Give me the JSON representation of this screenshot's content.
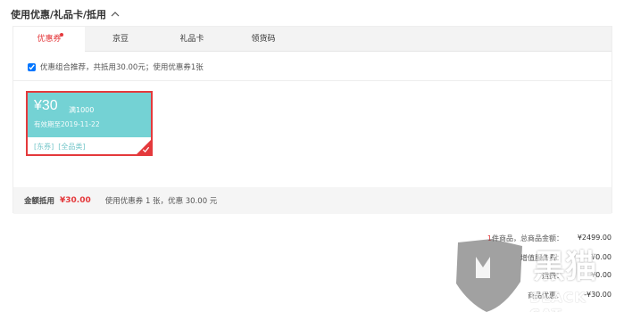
{
  "header": {
    "title": "使用优惠/礼品卡/抵用"
  },
  "tabs": [
    {
      "label": "优惠券",
      "active": true
    },
    {
      "label": "京豆"
    },
    {
      "label": "礼品卡"
    },
    {
      "label": "领货码"
    }
  ],
  "combo": {
    "label": "优惠组合推荐，共抵用30.00元；使用优惠券1张",
    "checked": true
  },
  "coupon": {
    "amount": "¥30",
    "condition": "满1000",
    "expiry": "有效期至2019-11-22",
    "tag1": "[东券]",
    "tag2": "[全品类]"
  },
  "summary": {
    "label": "金额抵用",
    "amount": "¥30.00",
    "desc": "使用优惠券 1 张，优惠 30.00 元"
  },
  "totals": {
    "row1_label": "件商品，总商品金额：",
    "row1_prefix": "1",
    "row1_value": "¥2499.00",
    "row2_label": "增值服务费：",
    "row2_value": "¥0.00",
    "row3_label": "运费：",
    "row3_value": "¥0.00",
    "row4_label": "商品优惠：",
    "row4_value": "-¥30.00"
  },
  "watermark": {
    "cn": "黑猫",
    "en": "BLACK CAT"
  },
  "colors": {
    "accent": "#e4393c",
    "coupon": "#74d2d4"
  }
}
